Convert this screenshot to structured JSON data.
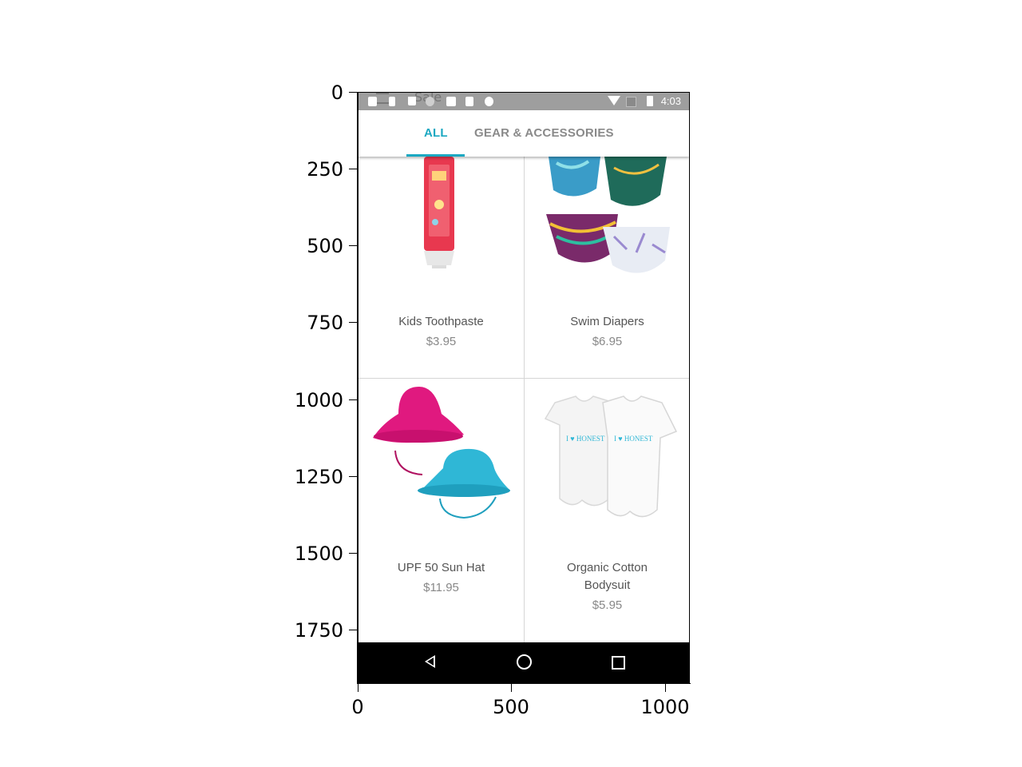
{
  "axes": {
    "y_ticks": [
      "0",
      "250",
      "500",
      "750",
      "1000",
      "1250",
      "1500",
      "1750"
    ],
    "x_ticks": [
      "0",
      "500",
      "1000"
    ]
  },
  "status_bar": {
    "time": "4:03",
    "behind_text": "Sale"
  },
  "tabs": [
    {
      "label": "ALL",
      "selected": true
    },
    {
      "label": "GEAR & ACCESSORIES",
      "selected": false
    }
  ],
  "products": [
    {
      "name": "Kids Toothpaste",
      "price": "$3.95"
    },
    {
      "name": "Swim Diapers",
      "price": "$6.95"
    },
    {
      "name": "UPF 50 Sun Hat",
      "price": "$11.95"
    },
    {
      "name_line1": "Organic Cotton",
      "name_line2": "Bodysuit",
      "price": "$5.95"
    }
  ],
  "bodysuit_print": "I ♥ HONEST",
  "colors": {
    "accent": "#1ba8c2",
    "statusbar": "#9e9e9e",
    "hat_pink": "#e0197f",
    "hat_blue": "#2fb7d6"
  }
}
